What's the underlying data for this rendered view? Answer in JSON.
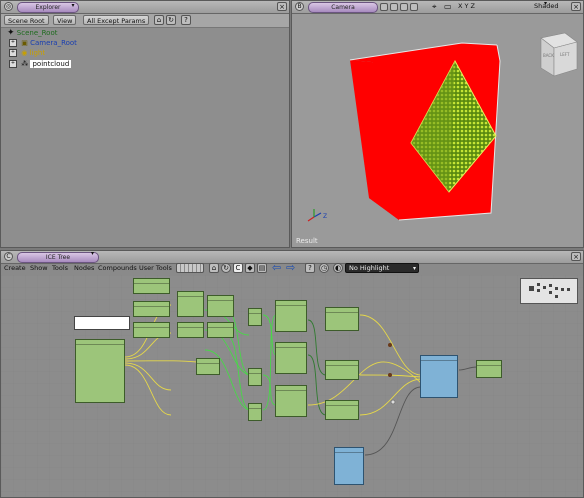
{
  "explorer": {
    "title": "Explorer",
    "toolbar": {
      "scope": "Scene Root",
      "view": "View",
      "filter": "All Except Params"
    },
    "tree": [
      {
        "label": "Scene_Root",
        "color": "#1f6b1f"
      },
      {
        "label": "Camera_Root",
        "color": "#1a3fb0"
      },
      {
        "label": "light",
        "color": "#c8a000"
      },
      {
        "label": "pointcloud",
        "color": "#000000"
      }
    ]
  },
  "viewport": {
    "camera_label": "Camera",
    "axes_label": "X Y Z",
    "shading": "Shaded",
    "result_label": "Result",
    "cube_labels": {
      "front": "BACK",
      "side": "LEFT"
    }
  },
  "ice_tree": {
    "title": "ICE Tree",
    "menus": [
      "Create",
      "Show",
      "Tools",
      "Nodes",
      "Compounds",
      "User Tools"
    ],
    "highlight": "No Highlight"
  },
  "colors": {
    "accent": "#a88bbf",
    "cube": "#ff0000",
    "points": "#c6e636",
    "node_green": "#9cc57a",
    "node_blue": "#7fb2d6",
    "wire_yellow": "#e6d84a"
  }
}
